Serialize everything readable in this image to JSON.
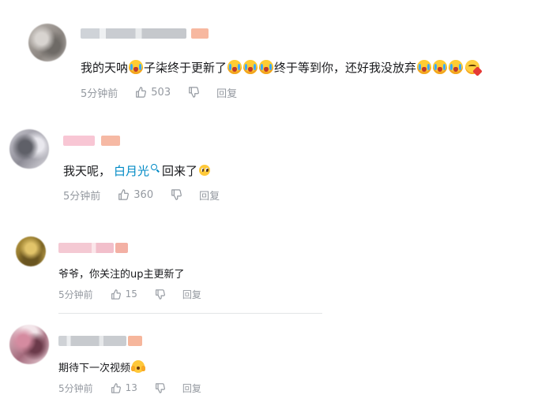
{
  "comments": [
    {
      "text_a": "我的天呐",
      "text_b": "子柒终于更新了",
      "text_c": "终于等到你，还好我没放弃",
      "time": "5分钟前",
      "likes": "503",
      "reply": "回复"
    },
    {
      "text_a": "我天呢，",
      "link": "白月光",
      "text_b": "回来了",
      "time": "5分钟前",
      "likes": "360",
      "reply": "回复"
    },
    {
      "text": "爷爷，你关注的up主更新了",
      "time": "5分钟前",
      "likes": "15",
      "reply": "回复"
    },
    {
      "text": "期待下一次视频",
      "time": "5分钟前",
      "likes": "13",
      "reply": "回复"
    }
  ],
  "icons": {
    "like": "thumbs-up-icon",
    "dislike": "thumbs-down-icon",
    "crying_emoji": "loudly-crying-face-icon",
    "love_emoji": "face-blowing-kiss-icon",
    "pleading_emoji": "pleading-face-icon",
    "shock_emoji": "screaming-face-icon",
    "search": "search-icon"
  },
  "colors": {
    "link": "#008ac5",
    "meta": "#9499a0",
    "text": "#18191c"
  }
}
